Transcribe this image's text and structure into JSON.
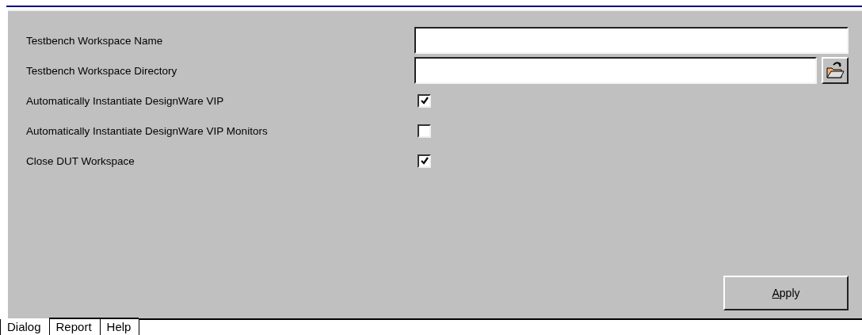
{
  "fields": [
    {
      "label": "Testbench Workspace Name",
      "kind": "text"
    },
    {
      "label": "Testbench Workspace Directory",
      "kind": "browse"
    }
  ],
  "options": [
    {
      "label": "Automatically Instantiate DesignWare VIP",
      "checked": true
    },
    {
      "label": "Automatically Instantiate DesignWare VIP Monitors",
      "checked": false
    },
    {
      "label": "Close DUT Workspace",
      "checked": true
    }
  ],
  "apply_button": "Apply",
  "tabs": [
    {
      "label": "Dialog",
      "selected": true
    },
    {
      "label": "Report",
      "selected": false
    },
    {
      "label": "Help",
      "selected": false
    }
  ]
}
